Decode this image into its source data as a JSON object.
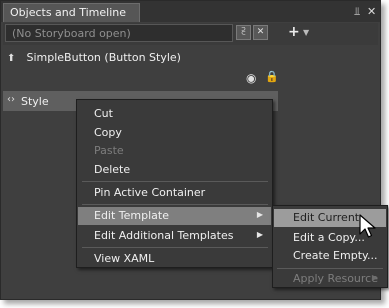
{
  "panel": {
    "title": "Objects and Timeline",
    "pin_icon": "pin-icon",
    "close_icon": "close-icon"
  },
  "storyboard": {
    "selector_text": "(No Storyboard open)",
    "dropdown_icon": "chevron-down-icon",
    "close_storyboard_icon": "close-icon",
    "new_storyboard_icon": "plus-icon",
    "new_storyboard_caret_icon": "caret-down-icon"
  },
  "tree": {
    "scope_label": "SimpleButton (Button Style)",
    "scope_icon": "scope-up-icon",
    "visibility_icon": "eye-icon",
    "lock_icon": "lock-icon",
    "style_label": "Style",
    "style_icon": "style-icon"
  },
  "context_menu": {
    "items": [
      {
        "label": "Cut",
        "disabled": false
      },
      {
        "label": "Copy",
        "disabled": false
      },
      {
        "label": "Paste",
        "disabled": true
      },
      {
        "label": "Delete",
        "disabled": false
      },
      {
        "label": "Pin Active Container",
        "disabled": false
      },
      {
        "label": "Edit Template",
        "disabled": false,
        "submenu": true,
        "highlighted": true
      },
      {
        "label": "Edit Additional Templates",
        "disabled": false,
        "submenu": true
      },
      {
        "label": "View XAML",
        "disabled": false
      }
    ]
  },
  "submenu": {
    "items": [
      {
        "label": "Edit Current",
        "highlighted": true
      },
      {
        "label": "Edit a Copy..."
      },
      {
        "label": "Create Empty..."
      },
      {
        "label": "Apply Resource",
        "disabled": true,
        "submenu": true
      }
    ]
  },
  "colors": {
    "panel_bg": "#3f3f3f",
    "menu_bg": "#3a3a3a",
    "highlight": "#7f7f7f",
    "submenu_highlight": "#9c9c9c"
  }
}
